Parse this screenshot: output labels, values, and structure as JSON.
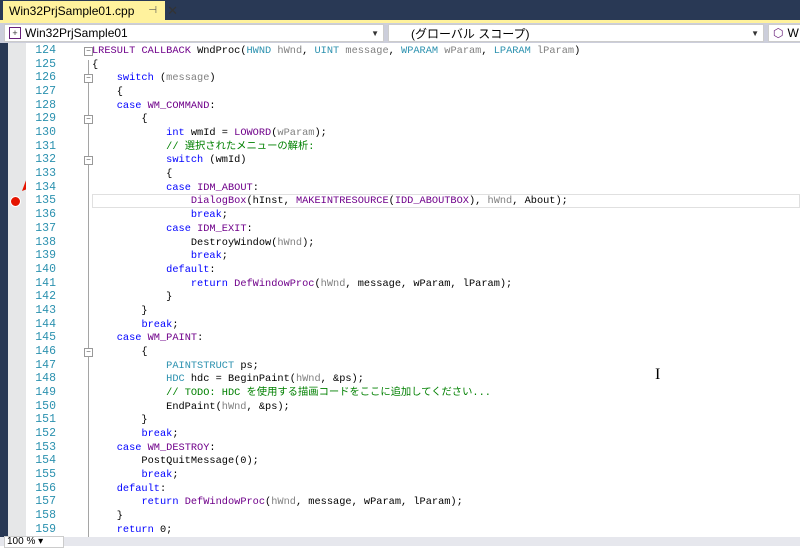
{
  "tab": {
    "title": "Win32PrjSample01.cpp",
    "pin": "⊣",
    "close": "✕"
  },
  "nav": {
    "project": "Win32PrjSample01",
    "scope": "(グローバル スコープ)",
    "member": "W"
  },
  "status": {
    "zoom": "100 %"
  },
  "breakpoint_line": 135,
  "current_line": 135,
  "fold_lines": [
    124,
    126,
    129,
    132,
    146
  ],
  "code_lines": [
    {
      "n": "124",
      "t": [
        [
          "LRESULT ",
          "m"
        ],
        [
          "CALLBACK ",
          "m"
        ],
        [
          "WndProc(",
          ""
        ],
        [
          "HWND ",
          "t"
        ],
        [
          "hWnd",
          "p"
        ],
        [
          ", ",
          ""
        ],
        [
          "UINT ",
          "t"
        ],
        [
          "message",
          "p"
        ],
        [
          ", ",
          ""
        ],
        [
          "WPARAM ",
          "t"
        ],
        [
          "wParam",
          "p"
        ],
        [
          ", ",
          ""
        ],
        [
          "LPARAM ",
          "t"
        ],
        [
          "lParam",
          "p"
        ],
        [
          ")",
          ""
        ]
      ]
    },
    {
      "n": "125",
      "t": [
        [
          "{",
          ""
        ]
      ]
    },
    {
      "n": "126",
      "t": [
        [
          "    ",
          ""
        ],
        [
          "switch",
          "k"
        ],
        [
          " (",
          ""
        ],
        [
          "message",
          "p"
        ],
        [
          ")",
          ""
        ]
      ]
    },
    {
      "n": "127",
      "t": [
        [
          "    {",
          ""
        ]
      ]
    },
    {
      "n": "128",
      "t": [
        [
          "    ",
          ""
        ],
        [
          "case ",
          "k"
        ],
        [
          "WM_COMMAND",
          "m"
        ],
        [
          ":",
          ""
        ]
      ]
    },
    {
      "n": "129",
      "t": [
        [
          "        {",
          ""
        ]
      ]
    },
    {
      "n": "130",
      "t": [
        [
          "            ",
          ""
        ],
        [
          "int",
          "k"
        ],
        [
          " wmId = ",
          ""
        ],
        [
          "LOWORD",
          "m"
        ],
        [
          "(",
          ""
        ],
        [
          "wParam",
          "p"
        ],
        [
          ");",
          ""
        ]
      ]
    },
    {
      "n": "131",
      "t": [
        [
          "            ",
          ""
        ],
        [
          "// 選択されたメニューの解析:",
          "c"
        ]
      ]
    },
    {
      "n": "132",
      "t": [
        [
          "            ",
          ""
        ],
        [
          "switch",
          "k"
        ],
        [
          " (wmId)",
          ""
        ]
      ]
    },
    {
      "n": "133",
      "t": [
        [
          "            {",
          ""
        ]
      ]
    },
    {
      "n": "134",
      "t": [
        [
          "            ",
          ""
        ],
        [
          "case ",
          "k"
        ],
        [
          "IDM_ABOUT",
          "m"
        ],
        [
          ":",
          ""
        ]
      ]
    },
    {
      "n": "135",
      "t": [
        [
          "                ",
          ""
        ],
        [
          "DialogBox",
          "m"
        ],
        [
          "(hInst, ",
          ""
        ],
        [
          "MAKEINTRESOURCE",
          "m"
        ],
        [
          "(",
          ""
        ],
        [
          "IDD_ABOUTBOX",
          "m"
        ],
        [
          "), ",
          ""
        ],
        [
          "hWnd",
          "p"
        ],
        [
          ", About);",
          ""
        ]
      ]
    },
    {
      "n": "136",
      "t": [
        [
          "                ",
          ""
        ],
        [
          "break",
          "k"
        ],
        [
          ";",
          ""
        ]
      ]
    },
    {
      "n": "137",
      "t": [
        [
          "            ",
          ""
        ],
        [
          "case ",
          "k"
        ],
        [
          "IDM_EXIT",
          "m"
        ],
        [
          ":",
          ""
        ]
      ]
    },
    {
      "n": "138",
      "t": [
        [
          "                DestroyWindow(",
          ""
        ],
        [
          "hWnd",
          "p"
        ],
        [
          ");",
          ""
        ]
      ]
    },
    {
      "n": "139",
      "t": [
        [
          "                ",
          ""
        ],
        [
          "break",
          "k"
        ],
        [
          ";",
          ""
        ]
      ]
    },
    {
      "n": "140",
      "t": [
        [
          "            ",
          ""
        ],
        [
          "default",
          "k"
        ],
        [
          ":",
          ""
        ]
      ]
    },
    {
      "n": "141",
      "t": [
        [
          "                ",
          ""
        ],
        [
          "return ",
          "k"
        ],
        [
          "DefWindowProc",
          "m"
        ],
        [
          "(",
          ""
        ],
        [
          "hWnd",
          "p"
        ],
        [
          ", message, wParam, lParam);",
          ""
        ]
      ]
    },
    {
      "n": "142",
      "t": [
        [
          "            }",
          ""
        ]
      ]
    },
    {
      "n": "143",
      "t": [
        [
          "        }",
          ""
        ]
      ]
    },
    {
      "n": "144",
      "t": [
        [
          "        ",
          ""
        ],
        [
          "break",
          "k"
        ],
        [
          ";",
          ""
        ]
      ]
    },
    {
      "n": "145",
      "t": [
        [
          "    ",
          ""
        ],
        [
          "case ",
          "k"
        ],
        [
          "WM_PAINT",
          "m"
        ],
        [
          ":",
          ""
        ]
      ]
    },
    {
      "n": "146",
      "t": [
        [
          "        {",
          ""
        ]
      ]
    },
    {
      "n": "147",
      "t": [
        [
          "            ",
          ""
        ],
        [
          "PAINTSTRUCT",
          "t"
        ],
        [
          " ps;",
          ""
        ]
      ]
    },
    {
      "n": "148",
      "t": [
        [
          "            ",
          ""
        ],
        [
          "HDC",
          "t"
        ],
        [
          " hdc = BeginPaint(",
          ""
        ],
        [
          "hWnd",
          "p"
        ],
        [
          ", &ps);",
          ""
        ]
      ]
    },
    {
      "n": "149",
      "t": [
        [
          "            ",
          ""
        ],
        [
          "// TODO: HDC を使用する描画コードをここに追加してください...",
          "c"
        ]
      ]
    },
    {
      "n": "150",
      "t": [
        [
          "            EndPaint(",
          ""
        ],
        [
          "hWnd",
          "p"
        ],
        [
          ", &ps);",
          ""
        ]
      ]
    },
    {
      "n": "151",
      "t": [
        [
          "        }",
          ""
        ]
      ]
    },
    {
      "n": "152",
      "t": [
        [
          "        ",
          ""
        ],
        [
          "break",
          "k"
        ],
        [
          ";",
          ""
        ]
      ]
    },
    {
      "n": "153",
      "t": [
        [
          "    ",
          ""
        ],
        [
          "case ",
          "k"
        ],
        [
          "WM_DESTROY",
          "m"
        ],
        [
          ":",
          ""
        ]
      ]
    },
    {
      "n": "154",
      "t": [
        [
          "        PostQuitMessage(0);",
          ""
        ]
      ]
    },
    {
      "n": "155",
      "t": [
        [
          "        ",
          ""
        ],
        [
          "break",
          "k"
        ],
        [
          ";",
          ""
        ]
      ]
    },
    {
      "n": "156",
      "t": [
        [
          "    ",
          ""
        ],
        [
          "default",
          "k"
        ],
        [
          ":",
          ""
        ]
      ]
    },
    {
      "n": "157",
      "t": [
        [
          "        ",
          ""
        ],
        [
          "return ",
          "k"
        ],
        [
          "DefWindowProc",
          "m"
        ],
        [
          "(",
          ""
        ],
        [
          "hWnd",
          "p"
        ],
        [
          ", message, wParam, lParam);",
          ""
        ]
      ]
    },
    {
      "n": "158",
      "t": [
        [
          "    }",
          ""
        ]
      ]
    },
    {
      "n": "159",
      "t": [
        [
          "    ",
          ""
        ],
        [
          "return ",
          "k"
        ],
        [
          "0;",
          ""
        ]
      ]
    }
  ]
}
